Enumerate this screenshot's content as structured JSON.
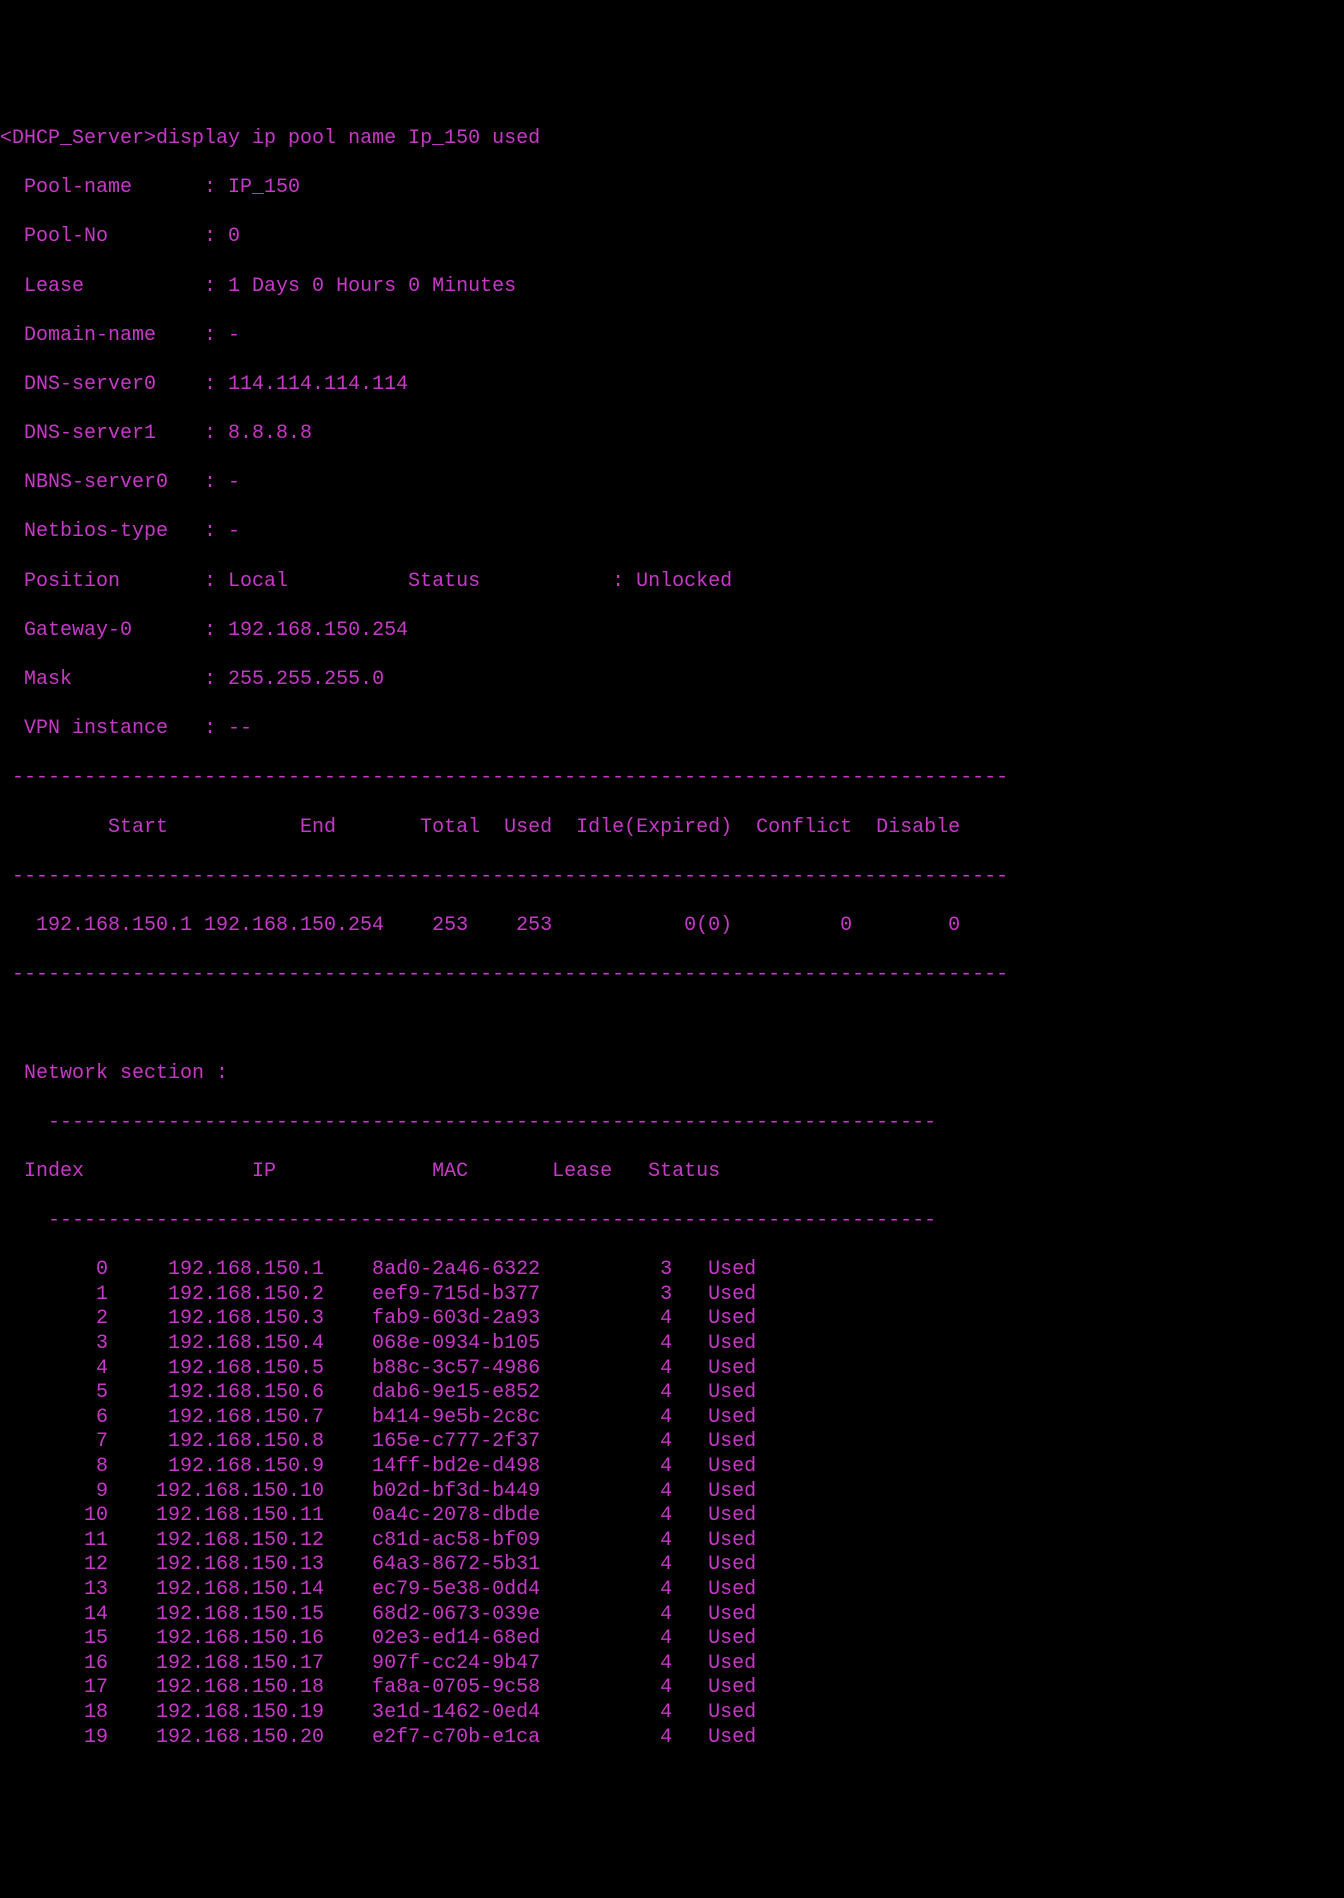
{
  "prompt": {
    "host": "<DHCP_Server>",
    "command": "display ip pool name Ip_150 used"
  },
  "pool_info": {
    "pool_name_label": "  Pool-name      : ",
    "pool_name_value": "IP_150",
    "pool_no_label": "  Pool-No        : ",
    "pool_no_value": "0",
    "lease_label": "  Lease          : ",
    "lease_value": "1 Days 0 Hours 0 Minutes",
    "domain_name_label": "  Domain-name    : ",
    "domain_name_value": "-",
    "dns0_label": "  DNS-server0    : ",
    "dns0_value": "114.114.114.114",
    "dns1_label": "  DNS-server1    : ",
    "dns1_value": "8.8.8.8",
    "nbns0_label": "  NBNS-server0   : ",
    "nbns0_value": "-",
    "netbios_label": "  Netbios-type   : ",
    "netbios_value": "-",
    "position_label": "  Position       : ",
    "position_value": "Local          ",
    "status_label": "Status           : ",
    "status_value": "Unlocked",
    "gateway_label": "  Gateway-0      : ",
    "gateway_value": "192.168.150.254",
    "mask_label": "  Mask           : ",
    "mask_value": "255.255.255.0",
    "vpn_label": "  VPN instance   : ",
    "vpn_value": "--"
  },
  "divider": " -----------------------------------------------------------------------------------",
  "pool_summary": {
    "header": "         Start           End       Total  Used  Idle(Expired)  Conflict  Disable",
    "row": " -----------------------------------------------------------------------------------",
    "data": "   192.168.150.1 192.168.150.254    253    253           0(0)         0        0"
  },
  "network_section": {
    "title": "  Network section : ",
    "divider": "    --------------------------------------------------------------------------",
    "header": "  Index              IP             MAC       Lease   Status  ",
    "rows": [
      "        0     192.168.150.1    8ad0-2a46-6322          3   Used       ",
      "        1     192.168.150.2    eef9-715d-b377          3   Used       ",
      "        2     192.168.150.3    fab9-603d-2a93          4   Used       ",
      "        3     192.168.150.4    068e-0934-b105          4   Used       ",
      "        4     192.168.150.5    b88c-3c57-4986          4   Used       ",
      "        5     192.168.150.6    dab6-9e15-e852          4   Used       ",
      "        6     192.168.150.7    b414-9e5b-2c8c          4   Used       ",
      "        7     192.168.150.8    165e-c777-2f37          4   Used       ",
      "        8     192.168.150.9    14ff-bd2e-d498          4   Used       ",
      "        9    192.168.150.10    b02d-bf3d-b449          4   Used       ",
      "       10    192.168.150.11    0a4c-2078-dbde          4   Used       ",
      "       11    192.168.150.12    c81d-ac58-bf09          4   Used       ",
      "       12    192.168.150.13    64a3-8672-5b31          4   Used       ",
      "       13    192.168.150.14    ec79-5e38-0dd4          4   Used       ",
      "       14    192.168.150.15    68d2-0673-039e          4   Used       ",
      "       15    192.168.150.16    02e3-ed14-68ed          4   Used       ",
      "       16    192.168.150.17    907f-cc24-9b47          4   Used       ",
      "       17    192.168.150.18    fa8a-0705-9c58          4   Used       ",
      "       18    192.168.150.19    3e1d-1462-0ed4          4   Used       ",
      "       19    192.168.150.20    e2f7-c70b-e1ca          4   Used       "
    ]
  }
}
